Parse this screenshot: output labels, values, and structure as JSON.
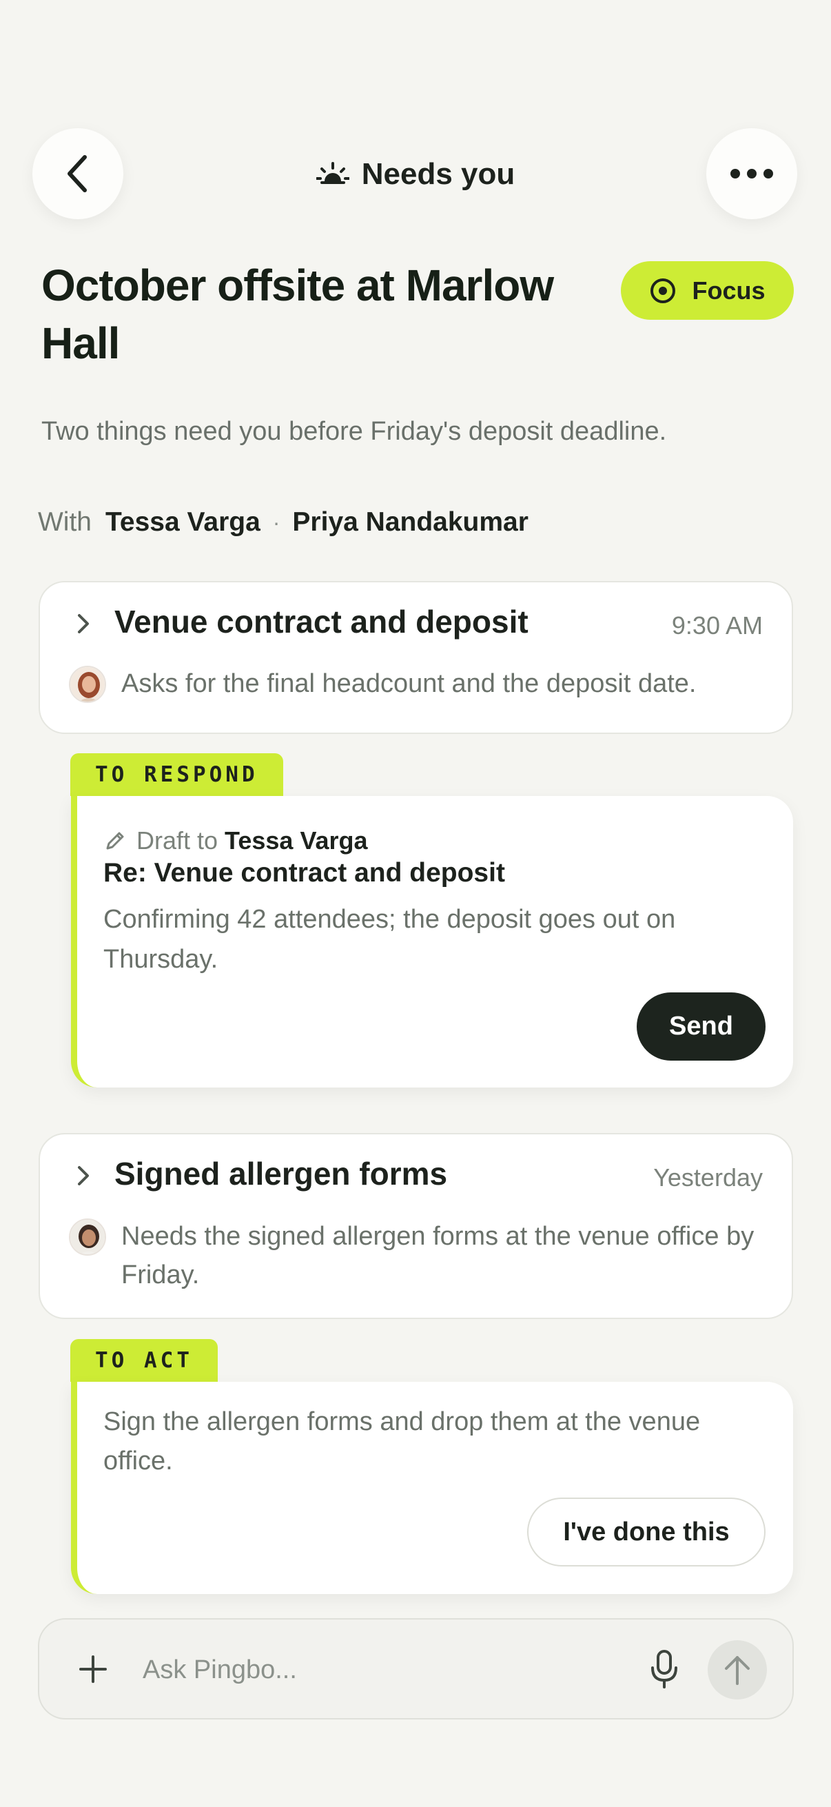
{
  "header": {
    "title": "Needs you",
    "back_icon": "chevron-left-icon",
    "more_icon": "more-horizontal-icon",
    "title_icon": "sun-icon"
  },
  "thread": {
    "title": "October offsite at Marlow Hall",
    "focus_label": "Focus",
    "subtitle": "Two things need you before Friday's deposit deadline.",
    "with_label": "With",
    "participants": [
      "Tessa Varga",
      "Priya Nandakumar"
    ],
    "separator": "·"
  },
  "items": [
    {
      "title": "Venue contract and deposit",
      "time": "9:30 AM",
      "summary": "Asks for the final headcount and the deposit date.",
      "tag": "TO RESPOND",
      "draft_label": "Draft to",
      "draft_recipient": "Tessa Varga",
      "draft_subject": "Re: Venue contract and deposit",
      "draft_body": "Confirming 42 attendees; the deposit goes out on Thursday.",
      "action_label": "Send"
    },
    {
      "title": "Signed allergen forms",
      "time": "Yesterday",
      "summary": "Needs the signed allergen forms at the venue office by Friday.",
      "tag": "TO ACT",
      "task": "Sign the allergen forms and drop them at the venue office.",
      "action_label": "I've done this"
    }
  ],
  "composer": {
    "placeholder": "Ask Pingbo...",
    "plus_icon": "plus-icon",
    "mic_icon": "microphone-icon",
    "send_icon": "arrow-up-icon"
  },
  "colors": {
    "background": "#f5f5f1",
    "accent": "#cdec35",
    "text": "#1d221d",
    "muted": "#6a716a",
    "send_button": "#1d241e"
  }
}
